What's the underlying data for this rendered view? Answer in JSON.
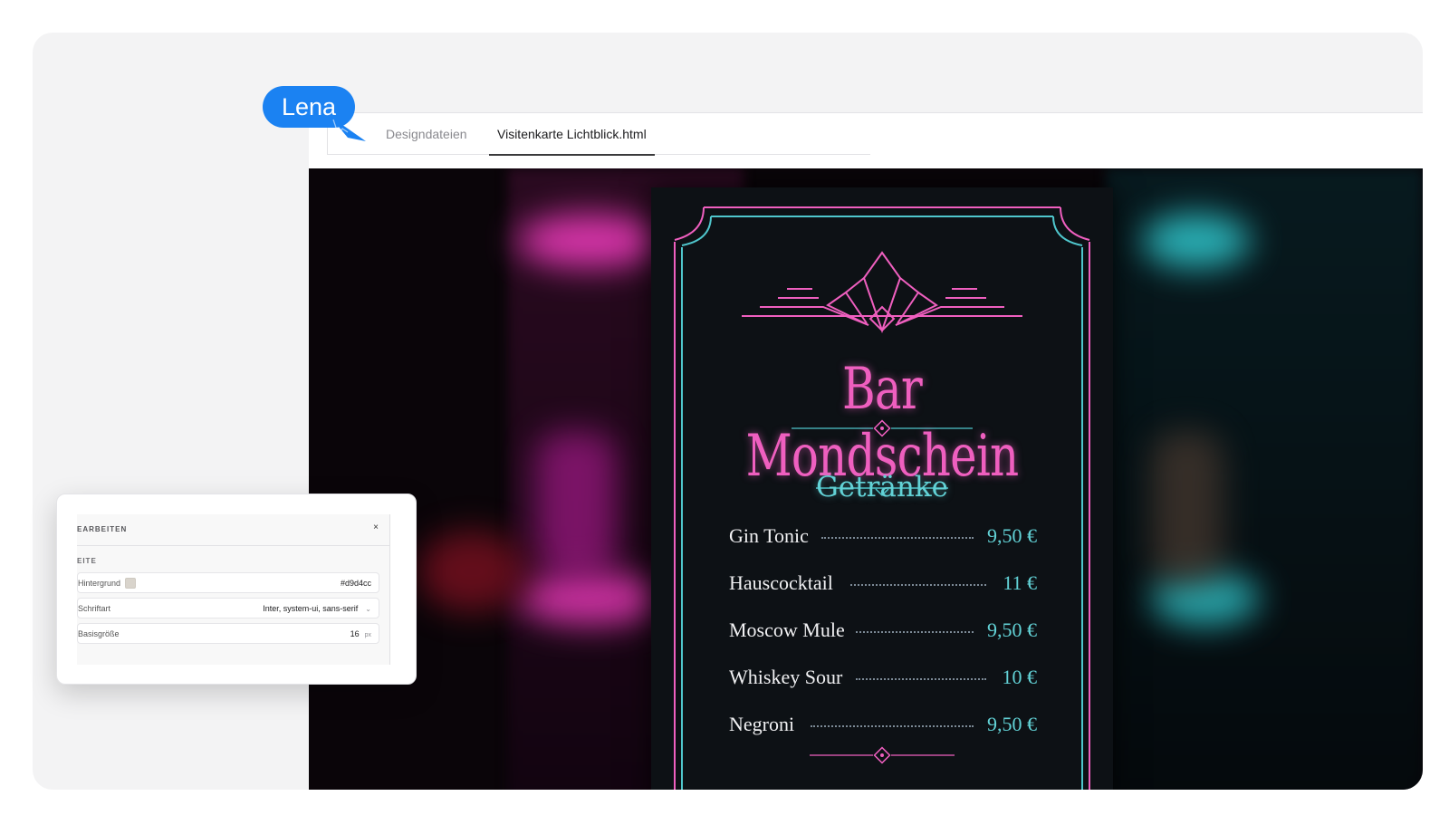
{
  "collaborator": {
    "name": "Lena"
  },
  "tabs": [
    {
      "label": "Designdateien",
      "active": false
    },
    {
      "label": "Visitenkarte Lichtblick.html",
      "active": true
    }
  ],
  "menu_card": {
    "title": "Bar Mondschein",
    "subtitle": "Getränke",
    "items": [
      {
        "name": "Gin Tonic",
        "price": "9,50 €"
      },
      {
        "name": "Hauscocktail",
        "price": "11 €"
      },
      {
        "name": "Moscow Mule",
        "price": "9,50 €"
      },
      {
        "name": "Whiskey Sour",
        "price": "10 €"
      },
      {
        "name": "Negroni",
        "price": "9,50 €"
      }
    ],
    "colors": {
      "pink": "#ef5fbf",
      "teal": "#62d2d6",
      "card": "#0d1115"
    }
  },
  "edit_panel": {
    "header": "EARBEITEN",
    "close_label": "×",
    "section": "EITE",
    "fields": [
      {
        "label": "Hintergrund",
        "value": "#d9d4cc"
      },
      {
        "label": "Schriftart",
        "value": "Inter, system-ui, sans-serif"
      },
      {
        "label": "Basisgröße",
        "value": "16",
        "unit": "px"
      }
    ]
  }
}
